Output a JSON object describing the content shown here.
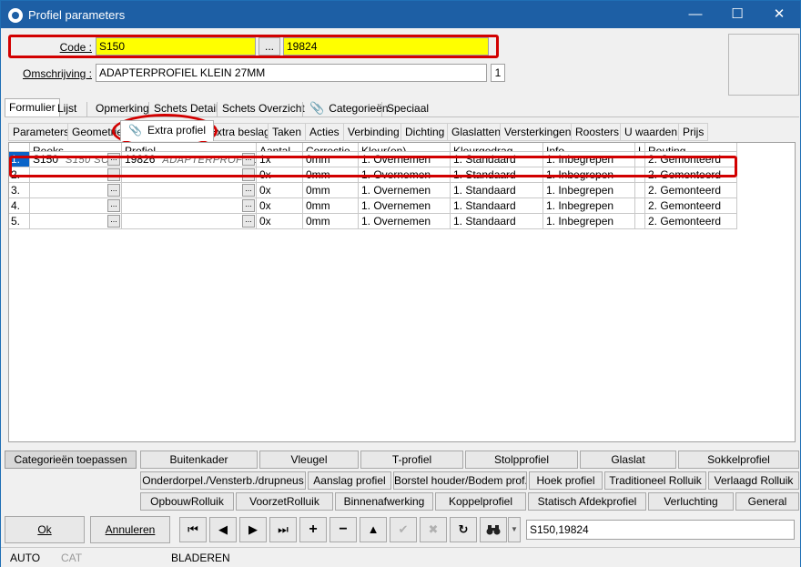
{
  "window": {
    "title": "Profiel parameters",
    "minimize": "—",
    "maximize": "☐",
    "close": "✕"
  },
  "header": {
    "code_label": "Code :",
    "code_value": "S150",
    "code_browse": "...",
    "code_number": "19824",
    "desc_label": "Omschrijving :",
    "desc_value": "ADAPTERPROFIEL KLEIN 27MM",
    "desc_count": "1"
  },
  "tabs": [
    "Formulier",
    "Lijst",
    "Opmerking",
    "Schets Detail",
    "Schets Overzicht",
    "Categorieën",
    "Speciaal"
  ],
  "subtabs": [
    "Parameters",
    "Geometrie",
    "Extra profiel",
    "Extra beslag",
    "Taken",
    "Acties",
    "Verbinding",
    "Dichting",
    "Glaslatten",
    "Versterkingen",
    "Roosters",
    "U waarden",
    "Prijs"
  ],
  "grid": {
    "columns": [
      "Reeks",
      "Profiel",
      "Aantal",
      "Correctie",
      "Kleur(en)",
      "Kleurgedrag",
      "Info",
      "L",
      "Routing"
    ],
    "rows": [
      {
        "num": "1.",
        "reeks": "S150",
        "reeks_desc": "S150 SO...",
        "profiel": "19826",
        "profiel_desc": "ADAPTERPROFIEL...",
        "aantal": "1x",
        "correctie": "0mm",
        "kleur": "1. Overnemen",
        "kleurgedrag": "1. Standaard",
        "info": "1. Inbegrepen",
        "l": "",
        "routing": "2. Gemonteerd"
      },
      {
        "num": "2.",
        "reeks": "",
        "reeks_desc": "",
        "profiel": "",
        "profiel_desc": "",
        "aantal": "0x",
        "correctie": "0mm",
        "kleur": "1. Overnemen",
        "kleurgedrag": "1. Standaard",
        "info": "1. Inbegrepen",
        "l": "",
        "routing": "2. Gemonteerd"
      },
      {
        "num": "3.",
        "reeks": "",
        "reeks_desc": "",
        "profiel": "",
        "profiel_desc": "",
        "aantal": "0x",
        "correctie": "0mm",
        "kleur": "1. Overnemen",
        "kleurgedrag": "1. Standaard",
        "info": "1. Inbegrepen",
        "l": "",
        "routing": "2. Gemonteerd"
      },
      {
        "num": "4.",
        "reeks": "",
        "reeks_desc": "",
        "profiel": "",
        "profiel_desc": "",
        "aantal": "0x",
        "correctie": "0mm",
        "kleur": "1. Overnemen",
        "kleurgedrag": "1. Standaard",
        "info": "1. Inbegrepen",
        "l": "",
        "routing": "2. Gemonteerd"
      },
      {
        "num": "5.",
        "reeks": "",
        "reeks_desc": "",
        "profiel": "",
        "profiel_desc": "",
        "aantal": "0x",
        "correctie": "0mm",
        "kleur": "1. Overnemen",
        "kleurgedrag": "1. Standaard",
        "info": "1. Inbegrepen",
        "l": "",
        "routing": "2. Gemonteerd"
      }
    ]
  },
  "categories": {
    "apply": "Categorieën toepassen",
    "row1": [
      "Buitenkader",
      "Vleugel",
      "T-profiel",
      "Stolpprofiel",
      "Glaslat",
      "Sokkelprofiel"
    ],
    "row2": [
      "Onderdorpel./Vensterb./drupneus",
      "Aanslag profiel",
      "Borstel houder/Bodem prof.",
      "Hoek profiel",
      "Traditioneel Rolluik",
      "Verlaagd Rolluik"
    ],
    "row3": [
      "OpbouwRolluik",
      "VoorzetRolluik",
      "Binnenafwerking",
      "Koppelprofiel",
      "Statisch Afdekprofiel",
      "Verluchting",
      "General"
    ]
  },
  "footer": {
    "ok": "Ok",
    "cancel": "Annuleren",
    "nav": [
      "⏮",
      "◀",
      "▶",
      "⏭",
      "+",
      "−",
      "▲",
      "✔",
      "✖",
      "↻"
    ],
    "search_value": "S150,19824"
  },
  "status": {
    "mode": "AUTO",
    "cat": "CAT",
    "state": "BLADEREN"
  },
  "colors": {
    "title_bar": "#1d5fa5",
    "highlight": "#ffff00",
    "annotation": "#d20000",
    "selection": "#0a64c8"
  }
}
